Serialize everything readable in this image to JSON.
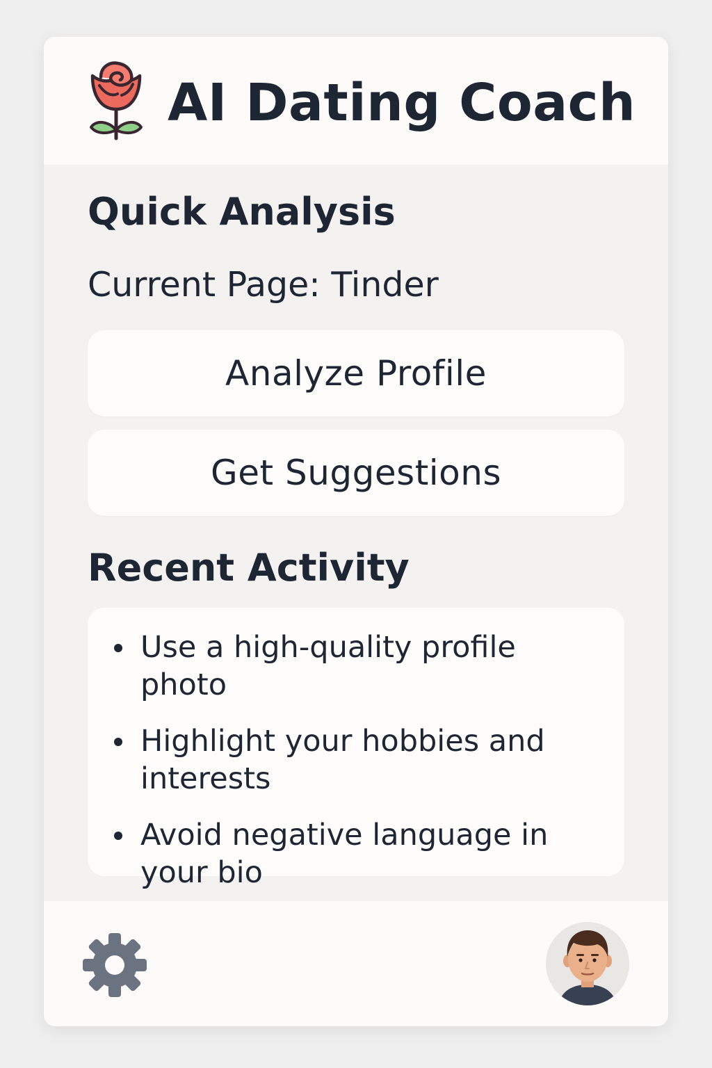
{
  "header": {
    "title": "AI Dating Coach",
    "logo_icon": "rose-icon"
  },
  "quick_analysis": {
    "title": "Quick Analysis",
    "current_page": "Current Page: Tinder",
    "buttons": {
      "analyze": "Analyze Profile",
      "suggestions": "Get Suggestions"
    }
  },
  "recent_activity": {
    "title": "Recent Activity",
    "items": [
      "Use a high-quality profile photo",
      "Highlight your hobbies and interests",
      "Avoid negative language in your bio"
    ]
  },
  "footer": {
    "settings_icon": "gear-icon",
    "avatar_icon": "user-avatar"
  },
  "colors": {
    "background": "#efefef",
    "panel": "#f3f2f1",
    "card": "#fdfcfb",
    "text": "#1f2633",
    "rose": "#e8665a",
    "leaf": "#8fcf8a",
    "gear": "#6b7280"
  }
}
